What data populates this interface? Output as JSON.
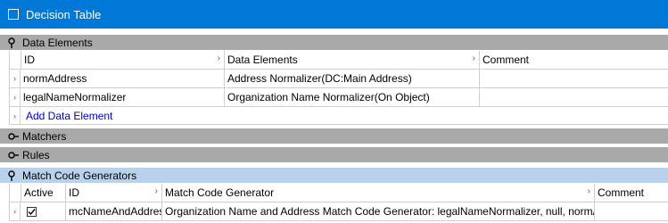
{
  "window": {
    "title": "Decision Table"
  },
  "sections": {
    "data_elements": {
      "title": "Data Elements",
      "columns": [
        "ID",
        "Data Elements",
        "Comment"
      ],
      "rows": [
        {
          "id": "normAddress",
          "element": "Address Normalizer(DC:Main Address)",
          "comment": ""
        },
        {
          "id": "legalNameNormalizer",
          "element": "Organization Name Normalizer(On Object)",
          "comment": ""
        }
      ],
      "add_label": "Add Data Element"
    },
    "matchers": {
      "title": "Matchers"
    },
    "rules": {
      "title": "Rules"
    },
    "match_code_generators": {
      "title": "Match Code Generators",
      "columns": [
        "Active",
        "ID",
        "Match Code Generator",
        "Comment"
      ],
      "rows": [
        {
          "active": true,
          "id": "mcNameAndAddress",
          "generator": "Organization Name and Address Match Code Generator: legalNameNormalizer, null, normAddress, ...",
          "comment": ""
        }
      ]
    }
  },
  "icons": {
    "title": "window-icon",
    "expanded": "pin-down-icon",
    "collapsed": "pin-right-icon",
    "row_selector": "chevron-right-icon"
  },
  "colors": {
    "titlebar": "#0078d7",
    "section_header": "#a9a9a9",
    "section_active": "#b9d1ea",
    "link": "#0000cc"
  }
}
